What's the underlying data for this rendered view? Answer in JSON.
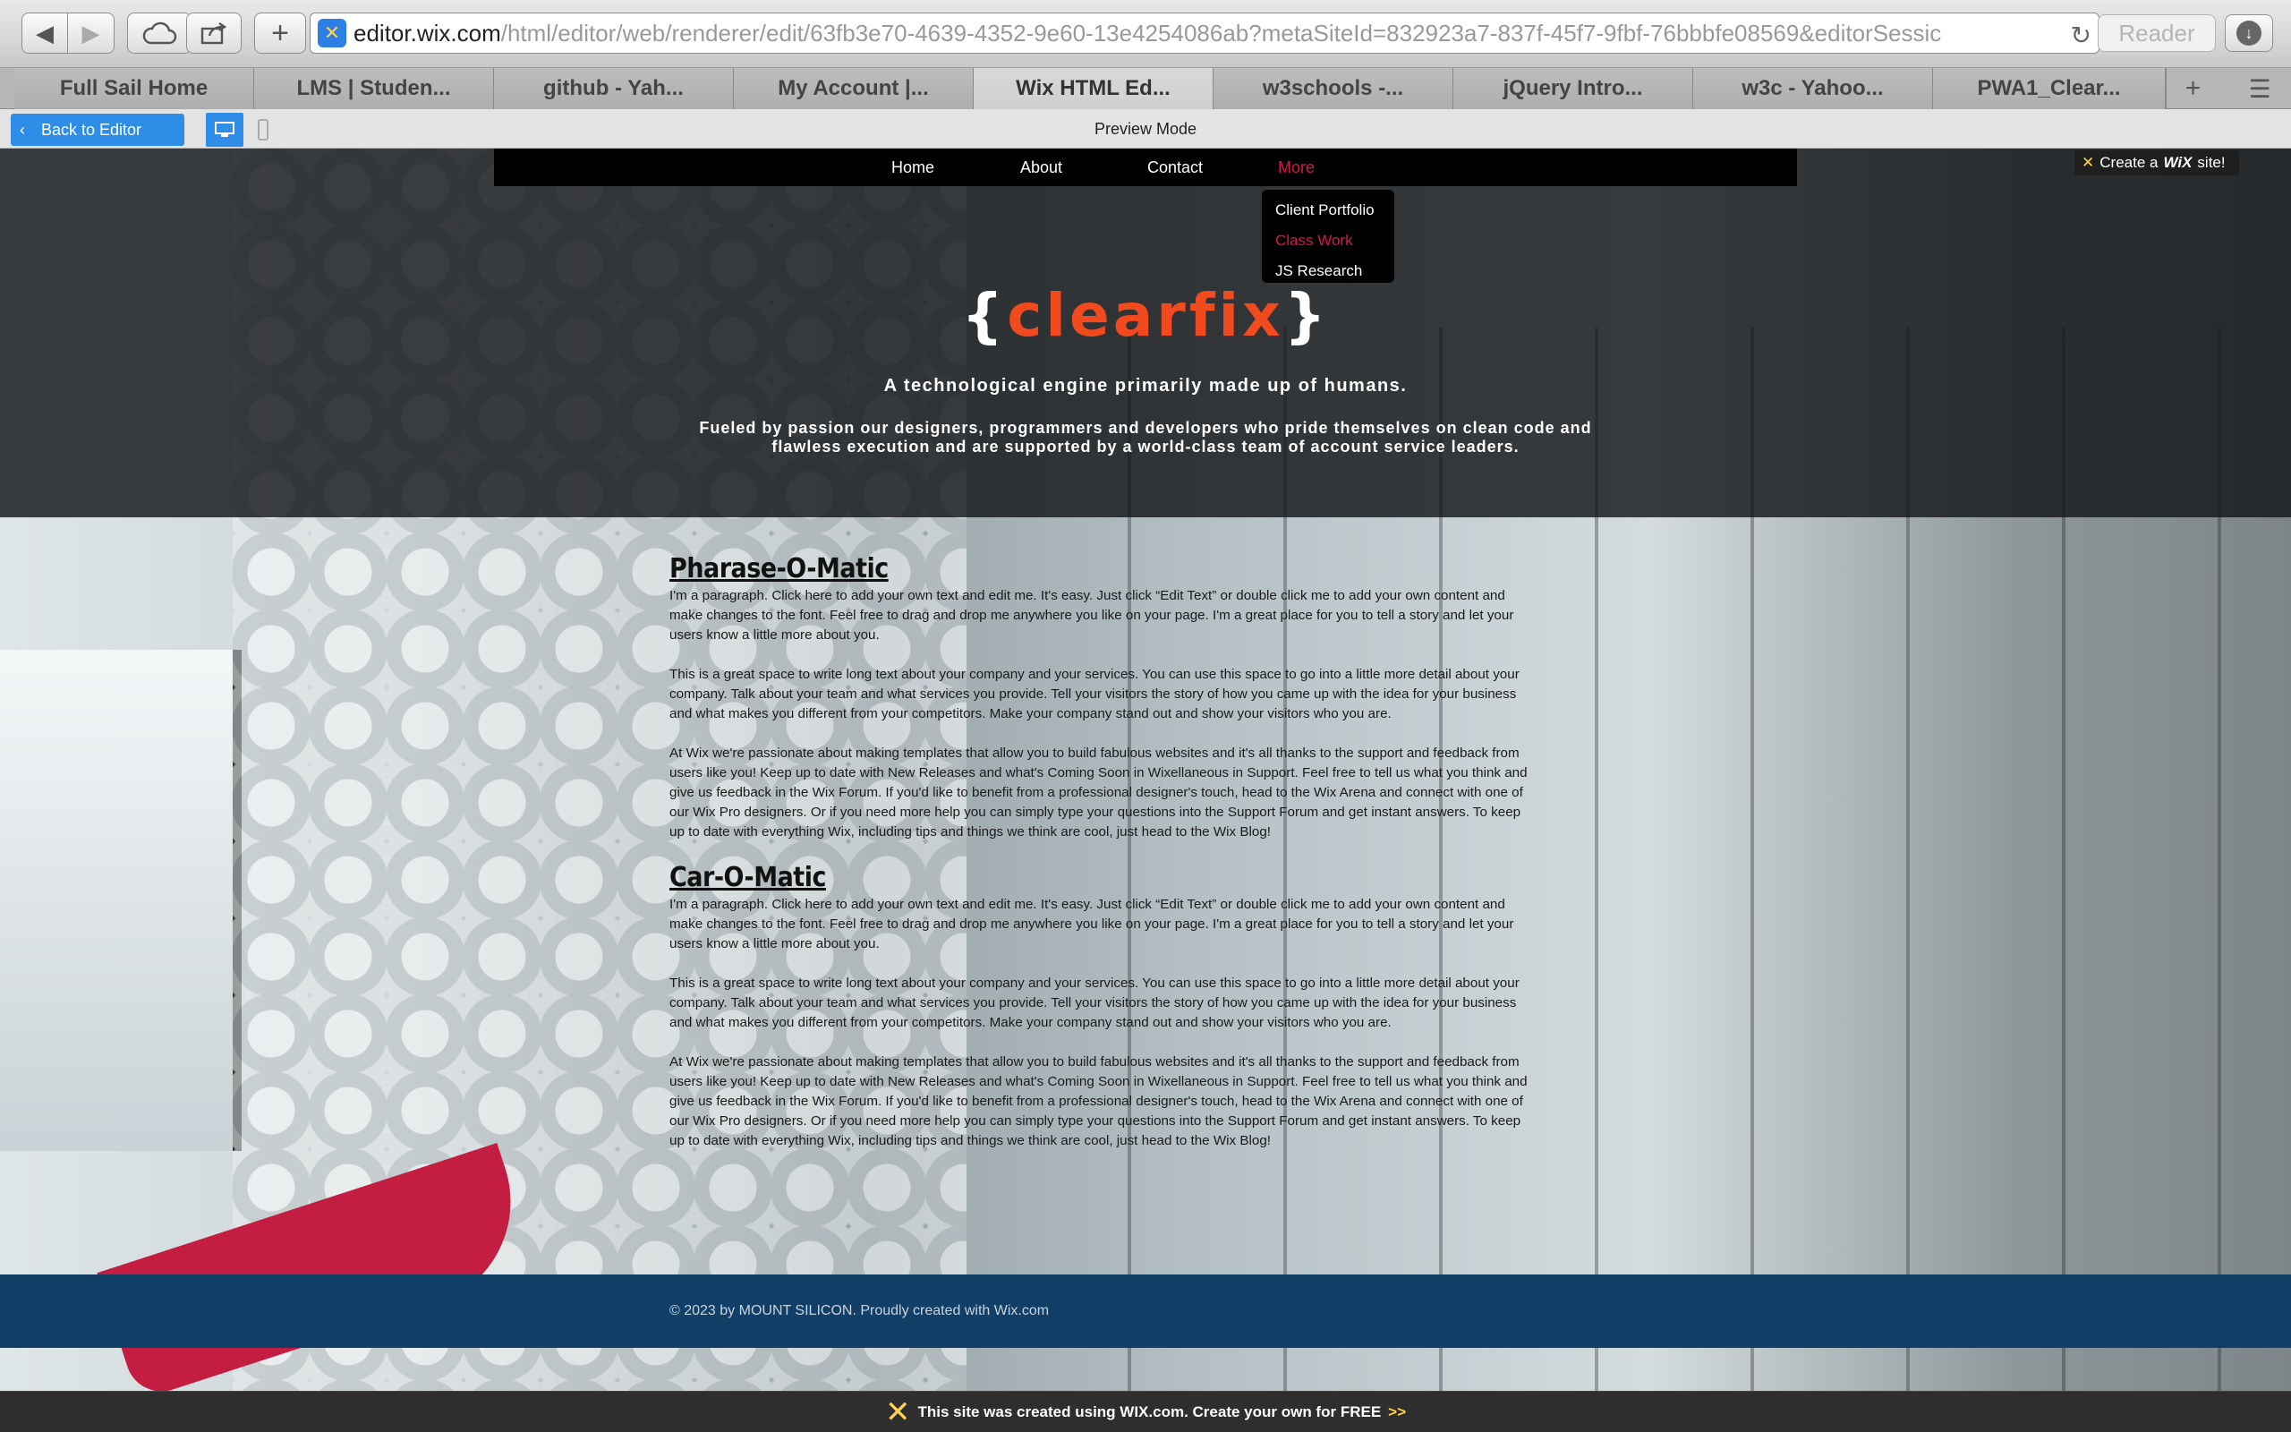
{
  "browser": {
    "url_host": "editor.wix.com",
    "url_path": "/html/editor/web/renderer/edit/63fb3e70-4639-4352-9e60-13e4254086ab?metaSiteId=832923a7-837f-45f7-9fbf-76bbbfe08569&editorSessic",
    "reader_label": "Reader",
    "tabs": [
      {
        "label": "Full Sail Home"
      },
      {
        "label": "LMS | Studen..."
      },
      {
        "label": "github - Yah..."
      },
      {
        "label": "My Account |..."
      },
      {
        "label": "Wix HTML Ed..."
      },
      {
        "label": "w3schools -..."
      },
      {
        "label": "jQuery Intro..."
      },
      {
        "label": "w3c - Yahoo..."
      },
      {
        "label": "PWA1_Clear..."
      }
    ],
    "active_tab_index": 4
  },
  "preview": {
    "back_label": "Back to Editor",
    "mode_label": "Preview Mode"
  },
  "site": {
    "menu": {
      "items": [
        {
          "label": "Home"
        },
        {
          "label": "About"
        },
        {
          "label": "Contact"
        },
        {
          "label": "More"
        }
      ],
      "dropdown": [
        {
          "label": "Client Portfolio"
        },
        {
          "label": "Class Work"
        },
        {
          "label": "JS Research"
        }
      ]
    },
    "badge": {
      "prefix": "Create a",
      "brand": "WiX",
      "suffix": "site!"
    },
    "logo": {
      "open": "{",
      "word": "clearfix",
      "close": "}"
    },
    "tagline": "A technological engine primarily made up of humans.",
    "subline": "Fueled by passion our designers, programmers and developers who pride themselves on clean code and flawless execution and are supported by a world-class team of account service leaders.",
    "sections": [
      {
        "title": "Pharase-O-Matic",
        "paragraphs": [
          "I'm a paragraph. Click here to add your own text and edit me. It's easy. Just click “Edit Text” or double click me to add your own content and make changes to the font. Feel free to drag and drop me anywhere you like on your page. I'm a great place for you to tell a story and let your users know a little more about you.",
          "This is a great space to write long text about your company and your services. You can use this space to go into a little more detail about your company. Talk about your team and what services you provide. Tell your visitors the story of how you came up with the idea for your business and what makes you different from your competitors. Make your company stand out and show your visitors who you are.",
          "At Wix we're passionate about making templates that allow you to build fabulous websites and it's all thanks to the support and feedback from users like you! Keep up to date with New Releases and what's Coming Soon in Wixellaneous in Support. Feel free to tell us what you think and give us feedback in the Wix Forum. If you'd like to benefit from a professional designer's touch, head to the Wix Arena and connect with one of our Wix Pro designers. Or if you need more help you can simply type your questions into the Support Forum and get instant answers. To keep up to date with everything Wix, including tips and things we think are cool, just head to the Wix Blog!"
        ]
      },
      {
        "title": "Car-O-Matic",
        "paragraphs": [
          "I'm a paragraph. Click here to add your own text and edit me. It's easy. Just click “Edit Text” or double click me to add your own content and make changes to the font. Feel free to drag and drop me anywhere you like on your page. I'm a great place for you to tell a story and let your users know a little more about you.",
          "This is a great space to write long text about your company and your services. You can use this space to go into a little more detail about your company. Talk about your team and what services you provide. Tell your visitors the story of how you came up with the idea for your business and what makes you different from your competitors. Make your company stand out and show your visitors who you are.",
          "At Wix we're passionate about making templates that allow you to build fabulous websites and it's all thanks to the support and feedback from users like you! Keep up to date with New Releases and what's Coming Soon in Wixellaneous in Support. Feel free to tell us what you think and give us feedback in the Wix Forum. If you'd like to benefit from a professional designer's touch, head to the Wix Arena and connect with one of our Wix Pro designers. Or if you need more help you can simply type your questions into the Support Forum and get instant answers. To keep up to date with everything Wix, including tips and things we think are cool, just head to the Wix Blog!"
        ]
      }
    ],
    "footer": "© 2023 by MOUNT SILICON. Proudly created with Wix.com"
  },
  "banner": {
    "text": "This site was created using WIX.com. Create your own for FREE",
    "cta": ">>"
  },
  "colors": {
    "accent_red": "#d6164c",
    "logo_orange": "#f24a1f",
    "wix_blue": "#2e8de6",
    "footer_navy": "#123f68",
    "wix_yellow": "#ffd24a"
  },
  "icons": {
    "back": "chevron-left-icon",
    "forward": "chevron-right-icon",
    "icloud": "cloud-icon",
    "share": "share-icon",
    "new_tab": "plus-icon",
    "reload": "reload-icon",
    "download": "download-icon",
    "desktop": "desktop-icon",
    "mobile": "mobile-icon"
  }
}
